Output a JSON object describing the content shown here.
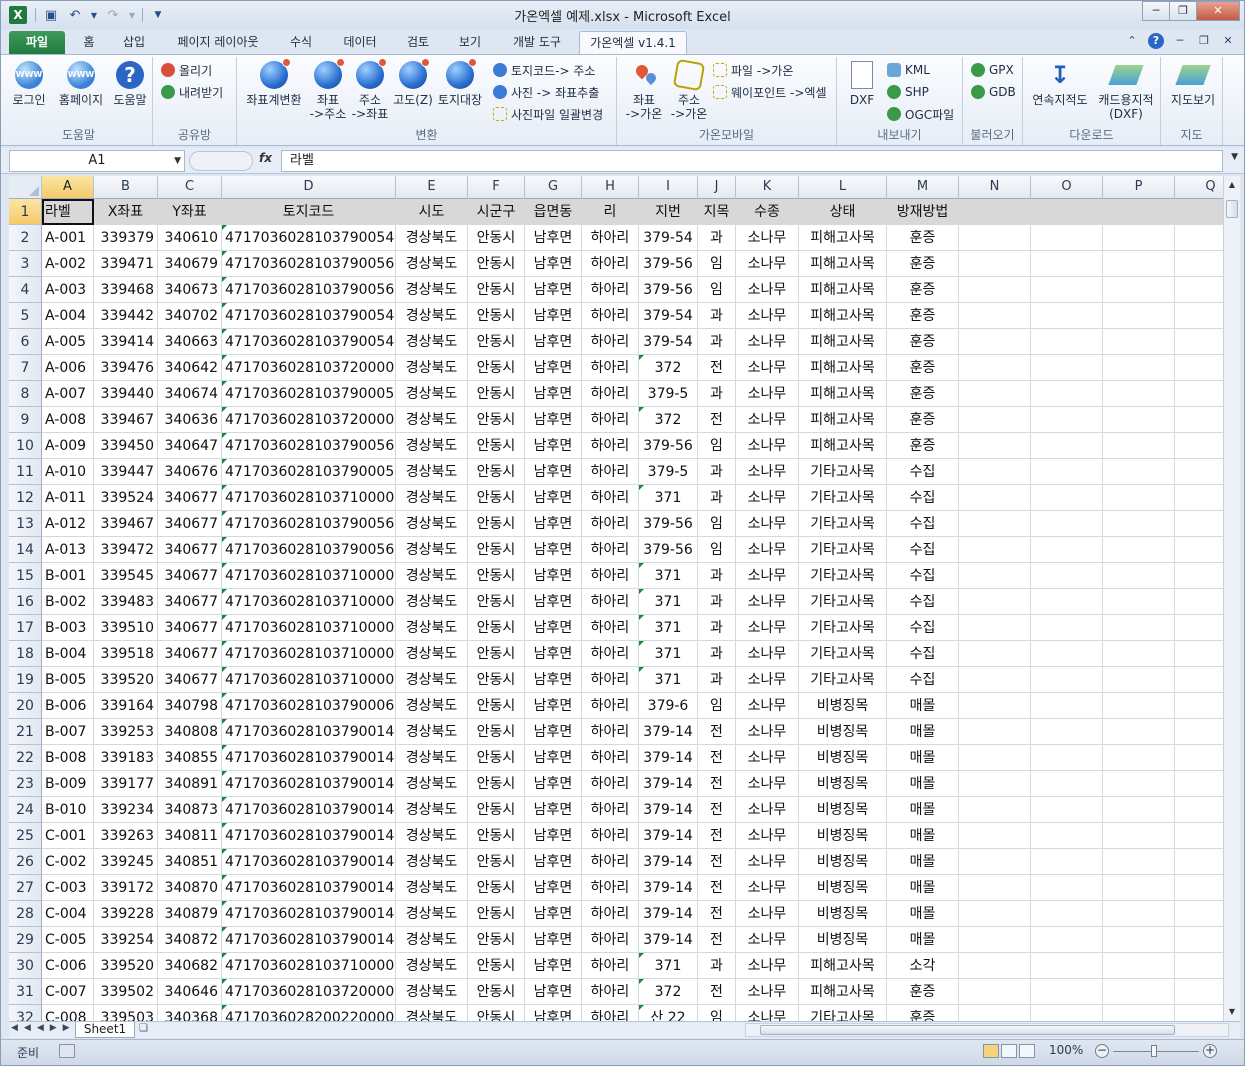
{
  "window": {
    "title": "가온엑셀 예제.xlsx  -  Microsoft Excel",
    "app_icon": "X"
  },
  "tabs": [
    {
      "label": "파일"
    },
    {
      "label": "홈"
    },
    {
      "label": "삽입"
    },
    {
      "label": "페이지 레이아웃"
    },
    {
      "label": "수식"
    },
    {
      "label": "데이터"
    },
    {
      "label": "검토"
    },
    {
      "label": "보기"
    },
    {
      "label": "개발 도구"
    },
    {
      "label": "가온엑셀 v1.4.1"
    }
  ],
  "ribbon": {
    "help_group": {
      "label": "도움말",
      "login": "로그인",
      "homepage": "홈페이지",
      "help": "도움말"
    },
    "share_group": {
      "label": "공유방",
      "upload": "올리기",
      "download": "내려받기"
    },
    "convert_group": {
      "label": "변환",
      "coord_convert": "좌표계변환",
      "coord_to_addr_1": "좌표",
      "coord_to_addr_2": "->주소",
      "addr_to_coord_1": "주소",
      "addr_to_coord_2": "->좌표",
      "altitude": "고도(Z)",
      "land_register": "토지대장",
      "landcode_to_addr": "토지코드-> 주소",
      "photo_to_coord": "사진 -> 좌표추출",
      "photo_batch": "사진파일 일괄변경"
    },
    "mobile_group": {
      "label": "가온모바일",
      "coord_to_gaon_1": "좌표",
      "coord_to_gaon_2": "->가온",
      "addr_to_gaon_1": "주소",
      "addr_to_gaon_2": "->가온",
      "file_to_gaon": "파일 ->가온",
      "waypoint_to_excel": "웨이포인트 ->엑셀"
    },
    "export_group": {
      "label": "내보내기",
      "dxf": "DXF",
      "kml": "KML",
      "shp": "SHP",
      "ogc": "OGC파일"
    },
    "import_group": {
      "label": "불러오기",
      "gpx": "GPX",
      "gdb": "GDB"
    },
    "download_group": {
      "label": "다운로드",
      "cadastral": "연속지적도",
      "cad_cadastral_1": "캐드용지적",
      "cad_cadastral_2": "(DXF)"
    },
    "map_group": {
      "label": "지도",
      "map_view": "지도보기"
    }
  },
  "formula_bar": {
    "name_box": "A1",
    "fx": "fx",
    "value": "라벨"
  },
  "columns": [
    "A",
    "B",
    "C",
    "D",
    "E",
    "F",
    "G",
    "H",
    "I",
    "J",
    "K",
    "L",
    "M",
    "N",
    "O",
    "P",
    "Q"
  ],
  "header_row": [
    "라벨",
    "X좌표",
    "Y좌표",
    "토지코드",
    "시도",
    "시군구",
    "읍면동",
    "리",
    "지번",
    "지목",
    "수종",
    "상태",
    "방재방법"
  ],
  "rows": [
    [
      "A-001",
      "339379",
      "340610",
      "4717036028103790054",
      "경상북도",
      "안동시",
      "남후면",
      "하아리",
      "379-54",
      "과",
      "소나무",
      "피해고사목",
      "훈증"
    ],
    [
      "A-002",
      "339471",
      "340679",
      "4717036028103790056",
      "경상북도",
      "안동시",
      "남후면",
      "하아리",
      "379-56",
      "임",
      "소나무",
      "피해고사목",
      "훈증"
    ],
    [
      "A-003",
      "339468",
      "340673",
      "4717036028103790056",
      "경상북도",
      "안동시",
      "남후면",
      "하아리",
      "379-56",
      "임",
      "소나무",
      "피해고사목",
      "훈증"
    ],
    [
      "A-004",
      "339442",
      "340702",
      "4717036028103790054",
      "경상북도",
      "안동시",
      "남후면",
      "하아리",
      "379-54",
      "과",
      "소나무",
      "피해고사목",
      "훈증"
    ],
    [
      "A-005",
      "339414",
      "340663",
      "4717036028103790054",
      "경상북도",
      "안동시",
      "남후면",
      "하아리",
      "379-54",
      "과",
      "소나무",
      "피해고사목",
      "훈증"
    ],
    [
      "A-006",
      "339476",
      "340642",
      "4717036028103720000",
      "경상북도",
      "안동시",
      "남후면",
      "하아리",
      "372",
      "전",
      "소나무",
      "피해고사목",
      "훈증"
    ],
    [
      "A-007",
      "339440",
      "340674",
      "4717036028103790005",
      "경상북도",
      "안동시",
      "남후면",
      "하아리",
      "379-5",
      "과",
      "소나무",
      "피해고사목",
      "훈증"
    ],
    [
      "A-008",
      "339467",
      "340636",
      "4717036028103720000",
      "경상북도",
      "안동시",
      "남후면",
      "하아리",
      "372",
      "전",
      "소나무",
      "피해고사목",
      "훈증"
    ],
    [
      "A-009",
      "339450",
      "340647",
      "4717036028103790056",
      "경상북도",
      "안동시",
      "남후면",
      "하아리",
      "379-56",
      "임",
      "소나무",
      "피해고사목",
      "훈증"
    ],
    [
      "A-010",
      "339447",
      "340676",
      "4717036028103790005",
      "경상북도",
      "안동시",
      "남후면",
      "하아리",
      "379-5",
      "과",
      "소나무",
      "기타고사목",
      "수집"
    ],
    [
      "A-011",
      "339524",
      "340677",
      "4717036028103710000",
      "경상북도",
      "안동시",
      "남후면",
      "하아리",
      "371",
      "과",
      "소나무",
      "기타고사목",
      "수집"
    ],
    [
      "A-012",
      "339467",
      "340677",
      "4717036028103790056",
      "경상북도",
      "안동시",
      "남후면",
      "하아리",
      "379-56",
      "임",
      "소나무",
      "기타고사목",
      "수집"
    ],
    [
      "A-013",
      "339472",
      "340677",
      "4717036028103790056",
      "경상북도",
      "안동시",
      "남후면",
      "하아리",
      "379-56",
      "임",
      "소나무",
      "기타고사목",
      "수집"
    ],
    [
      "B-001",
      "339545",
      "340677",
      "4717036028103710000",
      "경상북도",
      "안동시",
      "남후면",
      "하아리",
      "371",
      "과",
      "소나무",
      "기타고사목",
      "수집"
    ],
    [
      "B-002",
      "339483",
      "340677",
      "4717036028103710000",
      "경상북도",
      "안동시",
      "남후면",
      "하아리",
      "371",
      "과",
      "소나무",
      "기타고사목",
      "수집"
    ],
    [
      "B-003",
      "339510",
      "340677",
      "4717036028103710000",
      "경상북도",
      "안동시",
      "남후면",
      "하아리",
      "371",
      "과",
      "소나무",
      "기타고사목",
      "수집"
    ],
    [
      "B-004",
      "339518",
      "340677",
      "4717036028103710000",
      "경상북도",
      "안동시",
      "남후면",
      "하아리",
      "371",
      "과",
      "소나무",
      "기타고사목",
      "수집"
    ],
    [
      "B-005",
      "339520",
      "340677",
      "4717036028103710000",
      "경상북도",
      "안동시",
      "남후면",
      "하아리",
      "371",
      "과",
      "소나무",
      "기타고사목",
      "수집"
    ],
    [
      "B-006",
      "339164",
      "340798",
      "4717036028103790006",
      "경상북도",
      "안동시",
      "남후면",
      "하아리",
      "379-6",
      "임",
      "소나무",
      "비병징목",
      "매몰"
    ],
    [
      "B-007",
      "339253",
      "340808",
      "4717036028103790014",
      "경상북도",
      "안동시",
      "남후면",
      "하아리",
      "379-14",
      "전",
      "소나무",
      "비병징목",
      "매몰"
    ],
    [
      "B-008",
      "339183",
      "340855",
      "4717036028103790014",
      "경상북도",
      "안동시",
      "남후면",
      "하아리",
      "379-14",
      "전",
      "소나무",
      "비병징목",
      "매몰"
    ],
    [
      "B-009",
      "339177",
      "340891",
      "4717036028103790014",
      "경상북도",
      "안동시",
      "남후면",
      "하아리",
      "379-14",
      "전",
      "소나무",
      "비병징목",
      "매몰"
    ],
    [
      "B-010",
      "339234",
      "340873",
      "4717036028103790014",
      "경상북도",
      "안동시",
      "남후면",
      "하아리",
      "379-14",
      "전",
      "소나무",
      "비병징목",
      "매몰"
    ],
    [
      "C-001",
      "339263",
      "340811",
      "4717036028103790014",
      "경상북도",
      "안동시",
      "남후면",
      "하아리",
      "379-14",
      "전",
      "소나무",
      "비병징목",
      "매몰"
    ],
    [
      "C-002",
      "339245",
      "340851",
      "4717036028103790014",
      "경상북도",
      "안동시",
      "남후면",
      "하아리",
      "379-14",
      "전",
      "소나무",
      "비병징목",
      "매몰"
    ],
    [
      "C-003",
      "339172",
      "340870",
      "4717036028103790014",
      "경상북도",
      "안동시",
      "남후면",
      "하아리",
      "379-14",
      "전",
      "소나무",
      "비병징목",
      "매몰"
    ],
    [
      "C-004",
      "339228",
      "340879",
      "4717036028103790014",
      "경상북도",
      "안동시",
      "남후면",
      "하아리",
      "379-14",
      "전",
      "소나무",
      "비병징목",
      "매몰"
    ],
    [
      "C-005",
      "339254",
      "340872",
      "4717036028103790014",
      "경상북도",
      "안동시",
      "남후면",
      "하아리",
      "379-14",
      "전",
      "소나무",
      "비병징목",
      "매몰"
    ],
    [
      "C-006",
      "339520",
      "340682",
      "4717036028103710000",
      "경상북도",
      "안동시",
      "남후면",
      "하아리",
      "371",
      "과",
      "소나무",
      "피해고사목",
      "소각"
    ],
    [
      "C-007",
      "339502",
      "340646",
      "4717036028103720000",
      "경상북도",
      "안동시",
      "남후면",
      "하아리",
      "372",
      "전",
      "소나무",
      "피해고사목",
      "훈증"
    ],
    [
      "C-008",
      "339503",
      "340368",
      "4717036028200220000",
      "경상북도",
      "안동시",
      "남후면",
      "하아리",
      "산 22",
      "임",
      "소나무",
      "기타고사목",
      "훈증"
    ]
  ],
  "sheet_tab": "Sheet1",
  "status": {
    "ready": "준비",
    "zoom": "100%"
  },
  "colors": {
    "file_tab": "#1f7a3e",
    "selected_header": "#f5c96b",
    "text_indicator": "#188a2f"
  }
}
